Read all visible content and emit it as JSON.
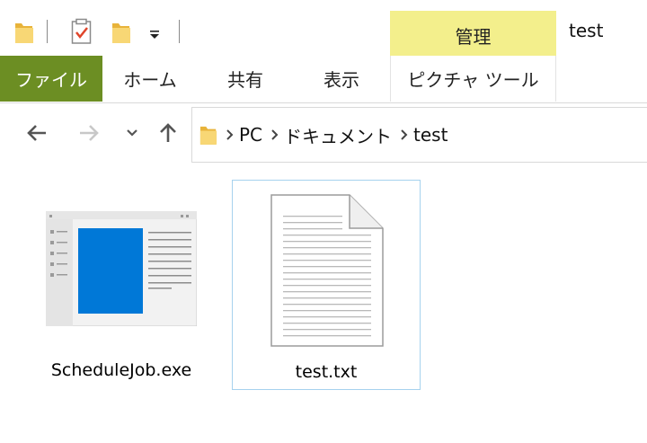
{
  "window": {
    "title": "test"
  },
  "quick_access": {
    "icons": [
      "folder-icon",
      "properties-checkmark-icon",
      "new-folder-icon",
      "customize-dropdown-icon"
    ]
  },
  "ribbon": {
    "contextual_group": "管理",
    "tabs": [
      {
        "label": "ファイル",
        "active": true
      },
      {
        "label": "ホーム"
      },
      {
        "label": "共有"
      },
      {
        "label": "表示"
      },
      {
        "label": "ピクチャ ツール"
      }
    ]
  },
  "navigation": {
    "icons": [
      "back-arrow-icon",
      "forward-arrow-icon",
      "recent-locations-chevron-icon",
      "up-arrow-icon"
    ],
    "breadcrumb": [
      "PC",
      "ドキュメント",
      "test"
    ]
  },
  "files": [
    {
      "name": "ScheduleJob.exe",
      "icon": "application-window-icon",
      "selected": false
    },
    {
      "name": "test.txt",
      "icon": "text-document-icon",
      "selected": true
    }
  ],
  "colors": {
    "file_tab": "#6c8e23",
    "manage_tab": "#f3ef8c",
    "selection_border": "#a6d2ee",
    "app_blue": "#0078d7"
  }
}
